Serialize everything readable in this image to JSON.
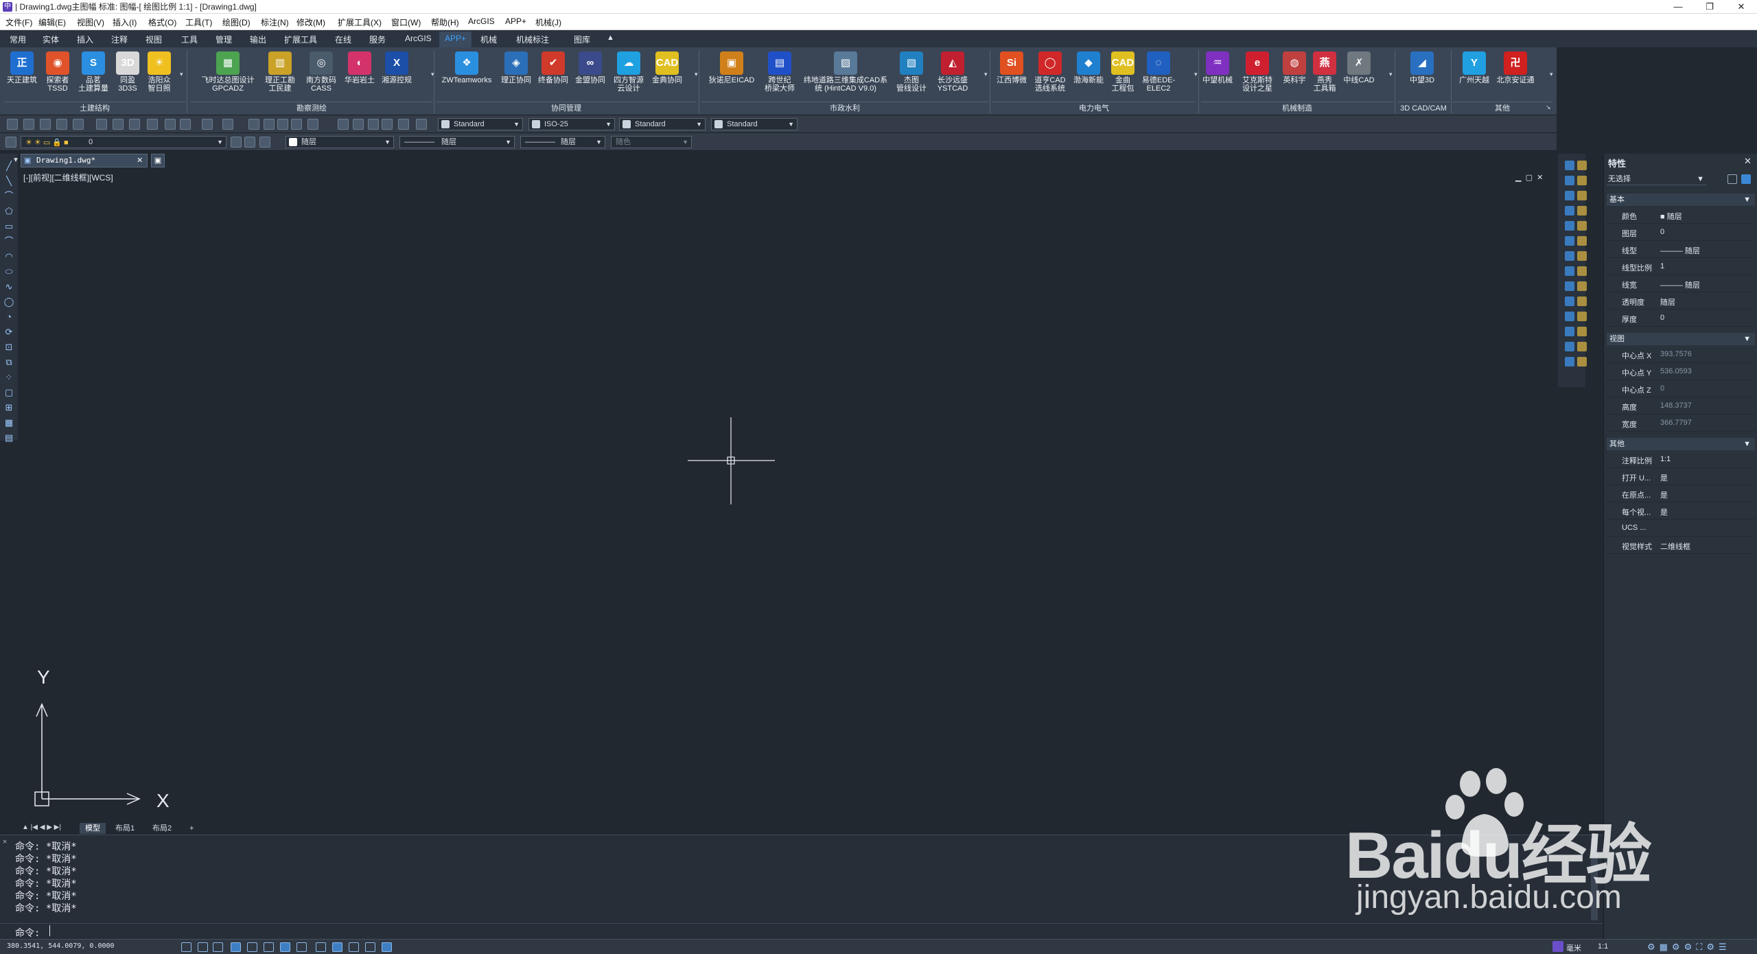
{
  "app": {
    "window_title": "| Drawing1.dwg主图幅 标准: 图幅-[ 绘图比例 1:1] - [Drawing1.dwg]",
    "logo": "中"
  },
  "menubar": {
    "items": [
      "文件(F)",
      "编辑(E)",
      "视图(V)",
      "插入(I)",
      "格式(O)",
      "工具(T)",
      "绘图(D)",
      "标注(N)",
      "修改(M)",
      "扩展工具(X)",
      "窗口(W)",
      "帮助(H)",
      "ArcGIS",
      "APP+",
      "机械(J)"
    ]
  },
  "ribbon_tabs": {
    "items": [
      "常用",
      "实体",
      "插入",
      "注释",
      "视图",
      "工具",
      "管理",
      "输出",
      "扩展工具",
      "在线",
      "服务",
      "ArcGIS",
      "APP+",
      "机械",
      "机械标注",
      "图库"
    ],
    "active": "APP+"
  },
  "ribbon": {
    "buttons": [
      {
        "label": "天正建筑",
        "glyph": "正",
        "color": "#1f6fd1"
      },
      {
        "label": "探索者\nTSSD",
        "glyph": "◉",
        "color": "#e0532a"
      },
      {
        "label": "品茗\n土建算量",
        "glyph": "S",
        "color": "#2a8fe0"
      },
      {
        "label": "同盈\n3D3S",
        "glyph": "3D",
        "color": "#d8d8d8"
      },
      {
        "label": "浩阳众\n智日照",
        "glyph": "☀",
        "color": "#f0c020"
      },
      {
        "label": "飞时达总图设计\nGPCADZ",
        "glyph": "▦",
        "color": "#4ca350"
      },
      {
        "label": "理正工勘\n工民建",
        "glyph": "▥",
        "color": "#c9a227"
      },
      {
        "label": "南方数码\nCASS",
        "glyph": "◎",
        "color": "#4a5b6c"
      },
      {
        "label": "华岩岩土",
        "glyph": "◐",
        "color": "#d4326a"
      },
      {
        "label": "湘源控规",
        "glyph": "X",
        "color": "#1b4fa8"
      },
      {
        "label": "ZWTeamworks",
        "glyph": "❖",
        "color": "#2b8fe0"
      },
      {
        "label": "理正协同",
        "glyph": "◈",
        "color": "#2b6fb8"
      },
      {
        "label": "终备协同",
        "glyph": "✔",
        "color": "#d03a2a"
      },
      {
        "label": "金盟协同",
        "glyph": "∞",
        "color": "#3a4a8a"
      },
      {
        "label": "四方智源\n云设计",
        "glyph": "☁",
        "color": "#1fa0e0"
      },
      {
        "label": "金典协同",
        "glyph": "CAD",
        "color": "#e0c020"
      },
      {
        "label": "狄诺尼EICAD",
        "glyph": "▣",
        "color": "#d0801a"
      },
      {
        "label": "跨世纪\n桥梁大师",
        "glyph": "▤",
        "color": "#2050c8"
      },
      {
        "label": "纬地道路三维集成CAD系\n统 (HintCAD V9.0)",
        "glyph": "▨",
        "color": "#5a7a9a"
      },
      {
        "label": "杰图\n管线设计",
        "glyph": "▧",
        "color": "#2080c0"
      },
      {
        "label": "长沙远盛\nYSTCAD",
        "glyph": "◭",
        "color": "#c02030"
      },
      {
        "label": "江西博微",
        "glyph": "Si",
        "color": "#e05020"
      },
      {
        "label": "道亨CAD\n选线系统",
        "glyph": "◯",
        "color": "#d02828"
      },
      {
        "label": "渤海新能",
        "glyph": "◆",
        "color": "#2080d0"
      },
      {
        "label": "金曲\n工程包",
        "glyph": "CAD",
        "color": "#e0c020"
      },
      {
        "label": "易德EDE-\nELEC2",
        "glyph": "◌",
        "color": "#2060c0"
      },
      {
        "label": "中望机械",
        "glyph": "♒",
        "color": "#8030c0"
      },
      {
        "label": "艾克斯特\n设计之星",
        "glyph": "e",
        "color": "#d02030"
      },
      {
        "label": "英科宇",
        "glyph": "◍",
        "color": "#c04040"
      },
      {
        "label": "燕秀\n工具箱",
        "glyph": "燕",
        "color": "#d03040"
      },
      {
        "label": "中线CAD",
        "glyph": "✗",
        "color": "#707880"
      },
      {
        "label": "中望3D",
        "glyph": "◢",
        "color": "#2a70c0"
      },
      {
        "label": "广州天越",
        "glyph": "Y",
        "color": "#20a0e0"
      },
      {
        "label": "北京安证通",
        "glyph": "卍",
        "color": "#d02020"
      }
    ],
    "groups": [
      "土建结构",
      "勘察测绘",
      "协同管理",
      "市政水利",
      "电力电气",
      "机械制造",
      "3D CAD/CAM",
      "其他"
    ]
  },
  "toolbar": {
    "text_style": "Standard",
    "dim_style": "ISO-25",
    "table_style": "Standard",
    "multileader_style": "Standard",
    "layer": "0",
    "color": "随层",
    "linetype": "随层",
    "lineweight": "随层",
    "plotstyle": "随色"
  },
  "document": {
    "tab_name": "Drawing1.dwg*",
    "view_label": "[-][前视][二维线框][WCS]"
  },
  "ucs": {
    "x": "X",
    "y": "Y"
  },
  "properties": {
    "title": "特性",
    "selection": "无选择",
    "basic": {
      "header": "基本",
      "rows": [
        {
          "k": "颜色",
          "v": "■ 随层"
        },
        {
          "k": "图层",
          "v": "0"
        },
        {
          "k": "线型",
          "v": "——— 随层"
        },
        {
          "k": "线型比例",
          "v": "1"
        },
        {
          "k": "线宽",
          "v": "——— 随层"
        },
        {
          "k": "透明度",
          "v": "随层"
        },
        {
          "k": "厚度",
          "v": "0"
        }
      ]
    },
    "view": {
      "header": "视图",
      "rows": [
        {
          "k": "中心点 X",
          "v": "393.7576"
        },
        {
          "k": "中心点 Y",
          "v": "536.0593"
        },
        {
          "k": "中心点 Z",
          "v": "0"
        },
        {
          "k": "高度",
          "v": "148.3737"
        },
        {
          "k": "宽度",
          "v": "366.7797"
        }
      ]
    },
    "misc": {
      "header": "其他",
      "rows": [
        {
          "k": "注释比例",
          "v": "1:1"
        },
        {
          "k": "打开 U...",
          "v": "是"
        },
        {
          "k": "在原点...",
          "v": "是"
        },
        {
          "k": "每个视...",
          "v": "是"
        },
        {
          "k": "UCS ...",
          "v": ""
        },
        {
          "k": "视觉样式",
          "v": "二维线框"
        }
      ]
    }
  },
  "layout_tabs": {
    "items": [
      "模型",
      "布局1",
      "布局2",
      "+"
    ],
    "active": "模型"
  },
  "command": {
    "history": [
      "命令: *取消*",
      "命令: *取消*",
      "命令: *取消*",
      "命令: *取消*",
      "命令: *取消*",
      "命令: *取消*"
    ],
    "prompt": "命令:"
  },
  "status": {
    "coords": "380.3541, 544.0079, 0.0000",
    "units": "毫米",
    "scale": "1:1"
  },
  "watermark": {
    "brand": "Baidu经验",
    "url": "jingyan.baidu.com"
  }
}
